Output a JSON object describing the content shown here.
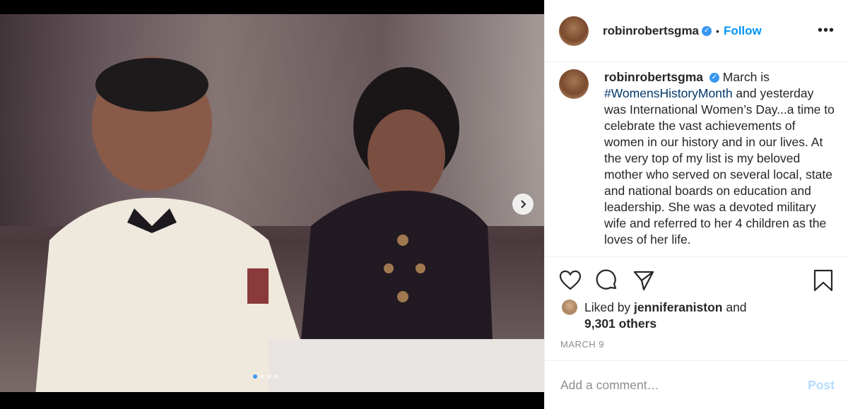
{
  "post": {
    "username": "robinrobertsgma",
    "follow_label": "Follow",
    "separator": "•",
    "more_label": "•••",
    "caption_text": "March is #WomensHistoryMonth and yesterday was International Women’s Day...a time to celebrate the vast achievements of women in our history and in our lives. At the very top of my list is my beloved mother who served on several local, state and national boards on education and leadership. She was a devoted military wife and referred to her 4 children as the loves of her life.",
    "caption_prefix": "March is ",
    "hashtag": "#WomensHistoryMonth",
    "caption_rest": " and yesterday was International Women’s Day...a time to celebrate the vast achievements of women in our history and in our lives. At the very top of my list is my beloved mother who served on several local, state and national boards on education and leadership. She was a devoted military wife and referred to her 4 children as the loves of her life.",
    "liked_by_prefix": "Liked by ",
    "liked_by_user": "jenniferaniston",
    "liked_by_and": " and",
    "liked_others": "9,301 others",
    "date": "MARCH 9"
  },
  "carousel": {
    "slide_count": 4,
    "active_index": 0
  },
  "comment": {
    "placeholder": "Add a comment…",
    "post_label": "Post"
  },
  "colors": {
    "accent": "#0095f6",
    "verified": "#3897f0",
    "post_disabled": "#b3dbff"
  },
  "icons": [
    "heart-icon",
    "comment-icon",
    "share-icon",
    "bookmark-icon",
    "chevron-right-icon",
    "verified-badge-icon"
  ]
}
